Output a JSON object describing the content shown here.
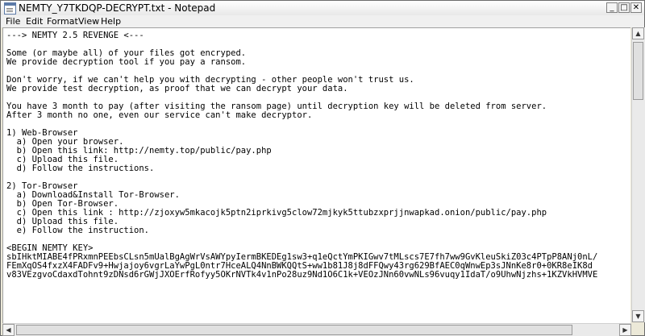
{
  "window": {
    "title": "NEMTY_Y7TKDQP-DECRYPT.txt - Notepad",
    "minimize_glyph": "_",
    "maximize_glyph": "□",
    "close_glyph": "✕"
  },
  "menu": {
    "items": [
      "File",
      "Edit",
      "Format",
      "View",
      "Help"
    ]
  },
  "document": {
    "lines": [
      "---> NEMTY 2.5 REVENGE <---",
      "",
      "Some (or maybe all) of your files got encryped.",
      "We provide decryption tool if you pay a ransom.",
      "",
      "Don't worry, if we can't help you with decrypting - other people won't trust us.",
      "We provide test decryption, as proof that we can decrypt your data.",
      "",
      "You have 3 month to pay (after visiting the ransom page) until decryption key will be deleted from server.",
      "After 3 month no one, even our service can't make decryptor.",
      "",
      "1) Web-Browser",
      "  a) Open your browser.",
      "  b) Open this link: http://nemty.top/public/pay.php",
      "  c) Upload this file.",
      "  d) Follow the instructions.",
      "",
      "2) Tor-Browser",
      "  a) Download&Install Tor-Browser.",
      "  b) Open Tor-Browser.",
      "  c) Open this link : http://zjoxyw5mkacojk5ptn2iprkivg5clow72mjkyk5ttubzxprjjnwapkad.onion/public/pay.php",
      "  d) Upload this file.",
      "  e) Follow the instruction.",
      "",
      "<BEGIN NEMTY KEY>",
      "sbIHktMIABE4fPRxmnPEEbsCLsn5mUalBgAgWrVsAWYpyIermBKEDEg1sw3+q1eQctYmPKIGwv7tMLscs7E7fh7ww9GvKleuSkiZ03c4PTpP8ANj0nL/",
      "FEmXqOS4fxzX4FADFv9+Hwjajoy6vgrLaYwPgL0ntr7HceALQ4NnBWKQQtS+ww1b81J8j8dFFQwy43rg629BfAEC0qWnwEp3sJNnKe8r0+0KR8eIK8d",
      "v83VEzgvoCdaxdTohnt9zDNsd6rGWjJXOErfRofyy5OKrNVTk4v1nPo28uz9Nd1O6C1k+VEOzJNn60vwNLs96vuqy1IdaT/o9UhwNjzhs+1KZVkHVMVE"
    ]
  }
}
